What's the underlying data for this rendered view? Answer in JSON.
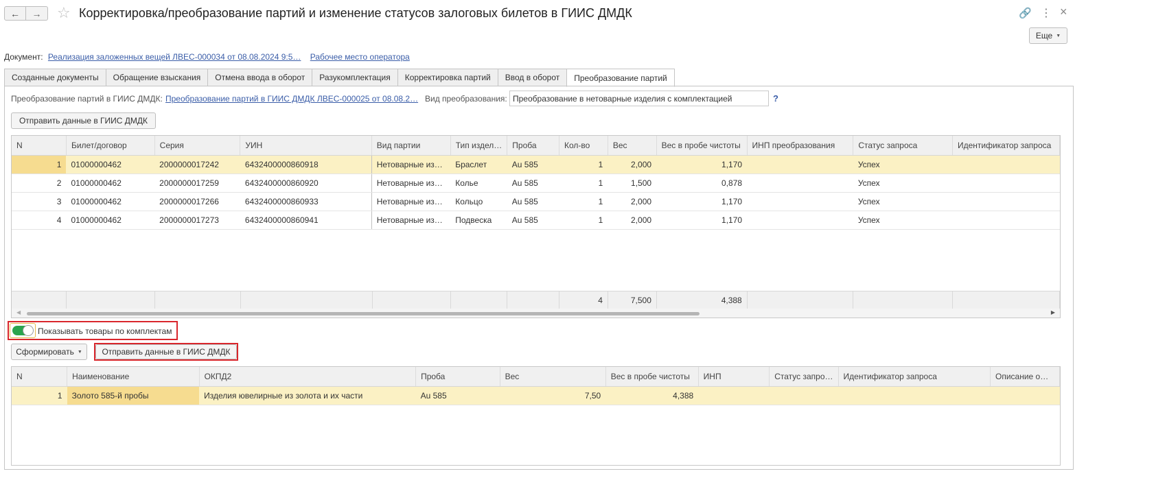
{
  "header": {
    "title": "Корректировка/преобразование партий и изменение статусов залоговых билетов в ГИИС ДМДК",
    "more_button": "Еще"
  },
  "document_row": {
    "label": "Документ:",
    "link": "Реализация заложенных вещей ЛВЕС-000034 от 08.08.2024 9:5…",
    "workplace_link": "Рабочее место оператора"
  },
  "tabs": [
    {
      "label": "Созданные документы"
    },
    {
      "label": "Обращение взыскания"
    },
    {
      "label": "Отмена ввода в оборот"
    },
    {
      "label": "Разукомплектация"
    },
    {
      "label": "Корректировка партий"
    },
    {
      "label": "Ввод в оборот"
    },
    {
      "label": "Преобразование партий"
    }
  ],
  "conversion": {
    "label": "Преобразование партий в ГИИС ДМДК:",
    "link": "Преобразование партий в ГИИС ДМДК ЛВЕС-000025 от 08.08.2…",
    "kind_label": "Вид преобразования:",
    "kind_value": "Преобразование в нетоварные изделия с комплектацией",
    "help": "?",
    "send_button": "Отправить данные в ГИИС ДМДК"
  },
  "table1": {
    "columns": [
      "N",
      "Билет/договор",
      "Серия",
      "УИН",
      "Вид партии",
      "Тип издел…",
      "Проба",
      "Кол-во",
      "Вес",
      "Вес в пробе чистоты",
      "ИНП преобразования",
      "Статус запроса",
      "Идентификатор запроса"
    ],
    "rows": [
      [
        "1",
        "01000000462",
        "2000000017242",
        "6432400000860918",
        "Нетоварные из…",
        "Браслет",
        "Au 585",
        "1",
        "2,000",
        "1,170",
        "",
        "Успех",
        ""
      ],
      [
        "2",
        "01000000462",
        "2000000017259",
        "6432400000860920",
        "Нетоварные из…",
        "Колье",
        "Au 585",
        "1",
        "1,500",
        "0,878",
        "",
        "Успех",
        ""
      ],
      [
        "3",
        "01000000462",
        "2000000017266",
        "6432400000860933",
        "Нетоварные из…",
        "Кольцо",
        "Au 585",
        "1",
        "2,000",
        "1,170",
        "",
        "Успех",
        ""
      ],
      [
        "4",
        "01000000462",
        "2000000017273",
        "6432400000860941",
        "Нетоварные из…",
        "Подвеска",
        "Au 585",
        "1",
        "2,000",
        "1,170",
        "",
        "Успех",
        ""
      ]
    ],
    "totals": {
      "qty": "4",
      "weight": "7,500",
      "pure_weight": "4,388"
    }
  },
  "toggle": {
    "label": "Показывать товары по комплектам",
    "on": true
  },
  "bottom_buttons": {
    "form": "Сформировать",
    "send": "Отправить данные в ГИИС ДМДК"
  },
  "table2": {
    "columns": [
      "N",
      "Наименование",
      "ОКПД2",
      "Проба",
      "Вес",
      "Вес в пробе чистоты",
      "ИНП",
      "Статус запро…",
      "Идентификатор запроса",
      "Описание о…"
    ],
    "rows": [
      [
        "1",
        "Золото 585-й пробы",
        "Изделия ювелирные из золота и их части",
        "Au 585",
        "7,50",
        "4,388",
        "",
        "",
        "",
        ""
      ]
    ]
  },
  "colors": {
    "accent_link": "#3a5da8",
    "selected_row": "#fbf1c4",
    "highlight_border": "#d9262c",
    "toggle_on": "#2aa44d"
  }
}
